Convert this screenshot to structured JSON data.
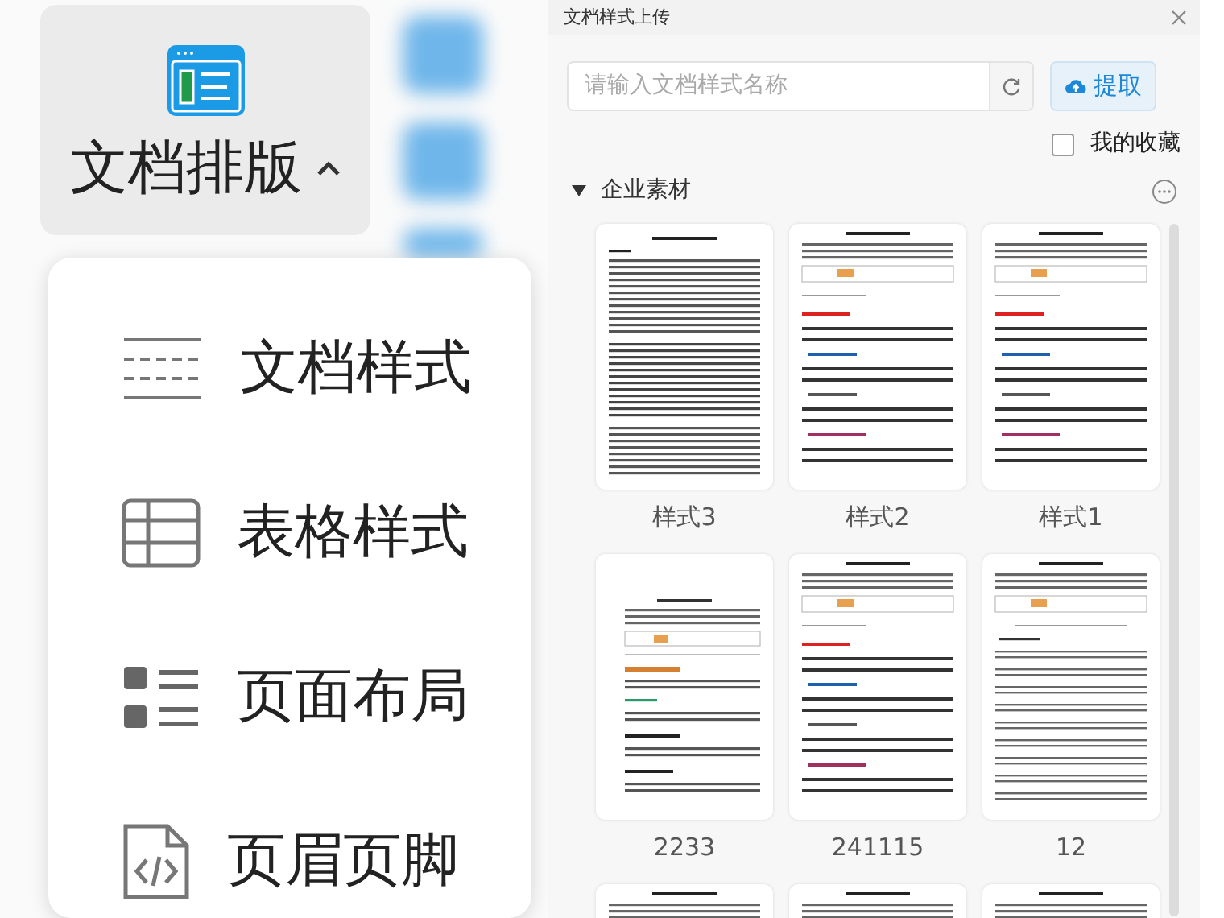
{
  "toolbar_button": {
    "label": "文档排版",
    "expanded": true
  },
  "menu": {
    "items": [
      {
        "label": "文档样式",
        "kind": "lines"
      },
      {
        "label": "表格样式",
        "kind": "table"
      },
      {
        "label": "页面布局",
        "kind": "layout"
      },
      {
        "label": "页眉页脚",
        "kind": "code"
      }
    ]
  },
  "panel": {
    "title": "文档样式上传",
    "search": {
      "placeholder": "请输入文档样式名称"
    },
    "extract_button": "提取",
    "favorites": {
      "label": "我的收藏",
      "checked": false
    },
    "section": {
      "title": "企业素材",
      "expanded": true
    },
    "templates": [
      {
        "name": "样式3",
        "kind": "report"
      },
      {
        "name": "样式2",
        "kind": "guide"
      },
      {
        "name": "样式1",
        "kind": "guide"
      },
      {
        "name": "2233",
        "kind": "mixed"
      },
      {
        "name": "241115",
        "kind": "guide"
      },
      {
        "name": "12",
        "kind": "compact"
      },
      {
        "kind": "guide"
      },
      {
        "kind": "guide"
      },
      {
        "kind": "guide"
      }
    ]
  }
}
